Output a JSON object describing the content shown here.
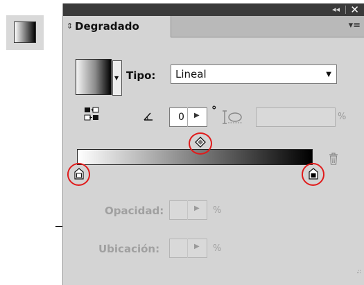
{
  "titlebar": {
    "collapse_icon": "double-chevron-left-icon",
    "close_icon": "close-icon",
    "collapse_text": "◂◂",
    "close_text": "✕"
  },
  "panel": {
    "tab_label": "Degradado",
    "tab_icon": "updown-arrows-icon",
    "tab_arrow_text": "⇕",
    "menu_icon": "panel-menu-icon",
    "menu_text": "▾≡"
  },
  "gradient": {
    "preview_drop_text": "▼",
    "type_label": "Tipo:",
    "type_value": "Lineal",
    "type_caret_text": "▼",
    "angle_value": "0",
    "angle_unit": "°",
    "stepper_text": "▶",
    "aspect_unit": "%",
    "start_color": "#ffffff",
    "end_color": "#000000",
    "highlight_color": "#e01b1b"
  },
  "stop": {
    "opacity_label": "Opacidad:",
    "opacity_unit": "%",
    "location_label": "Ubicación:",
    "location_unit": "%"
  },
  "grip_text": ".::"
}
